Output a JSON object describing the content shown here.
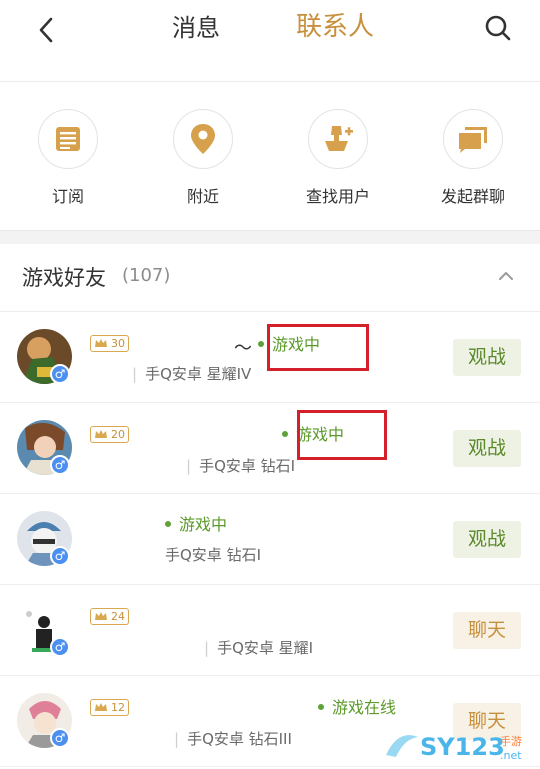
{
  "header": {
    "tab_messages": "消息",
    "tab_contacts": "联系人",
    "active_tab": "联系人",
    "accent_color": "#c8903c"
  },
  "actions": [
    {
      "label": "订阅",
      "icon": "subscribe-list-icon"
    },
    {
      "label": "附近",
      "icon": "location-pin-icon"
    },
    {
      "label": "查找用户",
      "icon": "add-user-icon"
    },
    {
      "label": "发起群聊",
      "icon": "group-chat-icon"
    }
  ],
  "section": {
    "title": "游戏好友",
    "count": "(107)"
  },
  "friends": [
    {
      "level": "30",
      "name_suffix": "〜",
      "status": "游戏中",
      "device": "手Q安卓 星耀IV",
      "button": "观战",
      "button_type": "watch",
      "highlighted": true
    },
    {
      "level": "20",
      "name_suffix": "",
      "status": "游戏中",
      "device": "手Q安卓 钻石I",
      "button": "观战",
      "button_type": "watch",
      "highlighted": true
    },
    {
      "level": "",
      "name_suffix": "",
      "status": "游戏中",
      "device": "手Q安卓 钻石I",
      "button": "观战",
      "button_type": "watch",
      "highlighted": false
    },
    {
      "level": "24",
      "name_suffix": "",
      "status": "",
      "device": "手Q安卓 星耀I",
      "button": "聊天",
      "button_type": "chat",
      "highlighted": false
    },
    {
      "level": "12",
      "name_suffix": "",
      "status": "游戏在线",
      "device": "手Q安卓 钻石III",
      "button": "聊天",
      "button_type": "chat",
      "highlighted": false
    }
  ],
  "watermark": {
    "text": "SY123",
    "sub": "手游",
    "domain": ".net"
  }
}
